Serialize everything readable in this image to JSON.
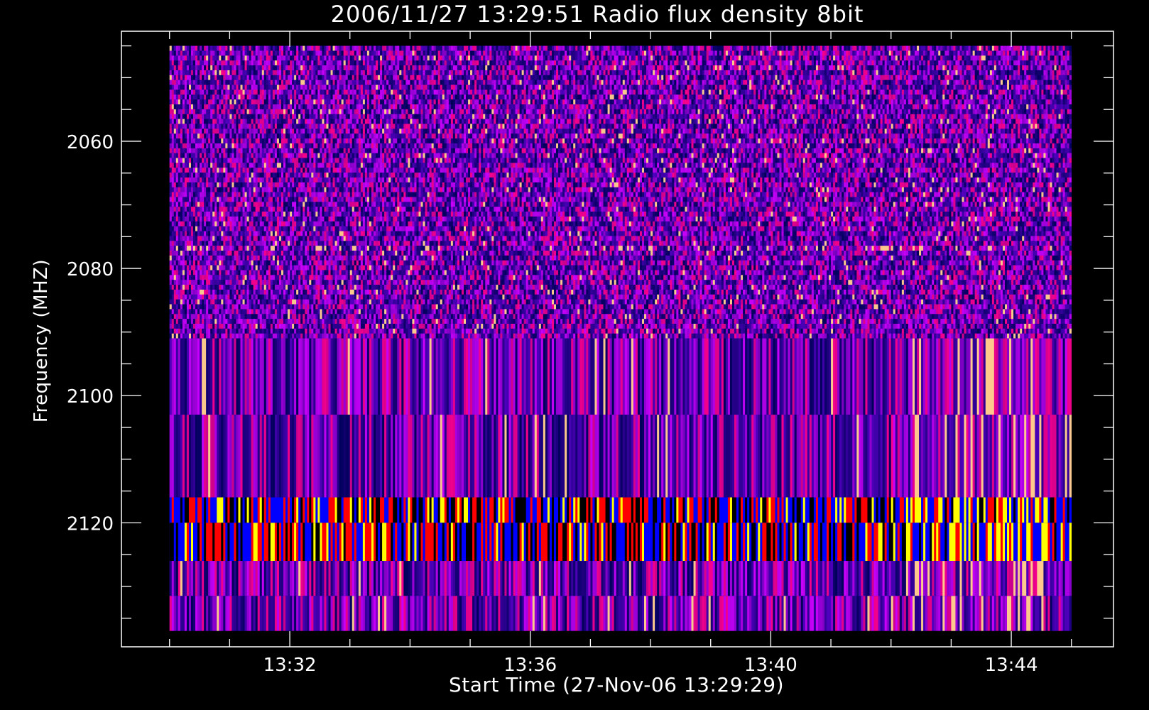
{
  "chart_data": {
    "type": "heatmap",
    "title": "2006/11/27 13:29:51 Radio flux density 8bit",
    "xlabel": "Start Time (27-Nov-06 13:29:29)",
    "ylabel": "Frequency (MHZ)",
    "x_ticks": [
      {
        "label": "13:32",
        "minutes": 2
      },
      {
        "label": "13:36",
        "minutes": 6
      },
      {
        "label": "13:40",
        "minutes": 10
      },
      {
        "label": "13:44",
        "minutes": 14
      }
    ],
    "x_minor_step_minutes": 1,
    "x_range_minutes": [
      -0.8,
      15.7
    ],
    "data_x_range_minutes": [
      0.0,
      15.0
    ],
    "y_ticks": [
      2060,
      2080,
      2100,
      2120
    ],
    "y_minor_step": 5,
    "y_range": [
      2042.7,
      2139.5
    ],
    "data_y_range": [
      2045.0,
      2137.0
    ],
    "y_reversed": true,
    "bands_mhz": [
      {
        "from": 2045.0,
        "to": 2091.0,
        "style": "noise"
      },
      {
        "from": 2091.0,
        "to": 2103.0,
        "style": "stripes"
      },
      {
        "from": 2103.0,
        "to": 2116.0,
        "style": "stripes"
      },
      {
        "from": 2116.0,
        "to": 2120.0,
        "style": "bright-stripes"
      },
      {
        "from": 2120.0,
        "to": 2126.0,
        "style": "bright-stripes"
      },
      {
        "from": 2126.0,
        "to": 2131.5,
        "style": "stripes"
      },
      {
        "from": 2131.5,
        "to": 2137.0,
        "style": "stripes"
      }
    ],
    "colormap": [
      "#000000",
      "#0000ff",
      "#ff0000",
      "#ffff00"
    ],
    "grid": false,
    "legend": "none"
  }
}
